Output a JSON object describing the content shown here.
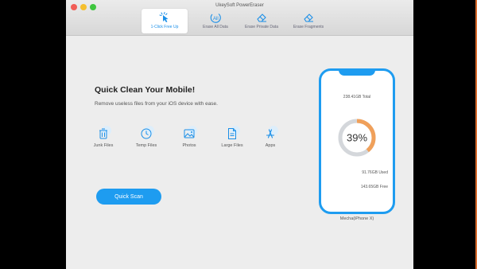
{
  "window": {
    "title": "UkeySoft PowerEraser"
  },
  "tabs": [
    {
      "label": "1-Click Free Up",
      "icon": "cursor-click-icon",
      "active": true
    },
    {
      "label": "Erase All Data",
      "icon": "erase-all-icon",
      "active": false
    },
    {
      "label": "Erase Private Data",
      "icon": "eraser-icon",
      "active": false
    },
    {
      "label": "Erase Fragments",
      "icon": "eraser-icon",
      "active": false
    }
  ],
  "main": {
    "title": "Quick Clean Your Mobile!",
    "subtitle": "Remove useless files from your iOS device with ease.",
    "categories": [
      {
        "label": "Junk Files",
        "icon": "trash-icon"
      },
      {
        "label": "Temp Files",
        "icon": "clock-icon"
      },
      {
        "label": "Photos",
        "icon": "photo-icon"
      },
      {
        "label": "Large Files",
        "icon": "file-icon"
      },
      {
        "label": "Apps",
        "icon": "app-store-icon"
      }
    ],
    "scan_button": "Quick Scan"
  },
  "device": {
    "capacity": "238.41GB Total",
    "used_percent": 39,
    "percent_label": "39%",
    "used": "91.76GB Used",
    "free": "143.65GB Free",
    "name": "Mecha(iPhone X)"
  },
  "colors": {
    "accent": "#1e9cf0",
    "ring_used": "#f0a05a",
    "ring_free": "#d4d7db"
  }
}
